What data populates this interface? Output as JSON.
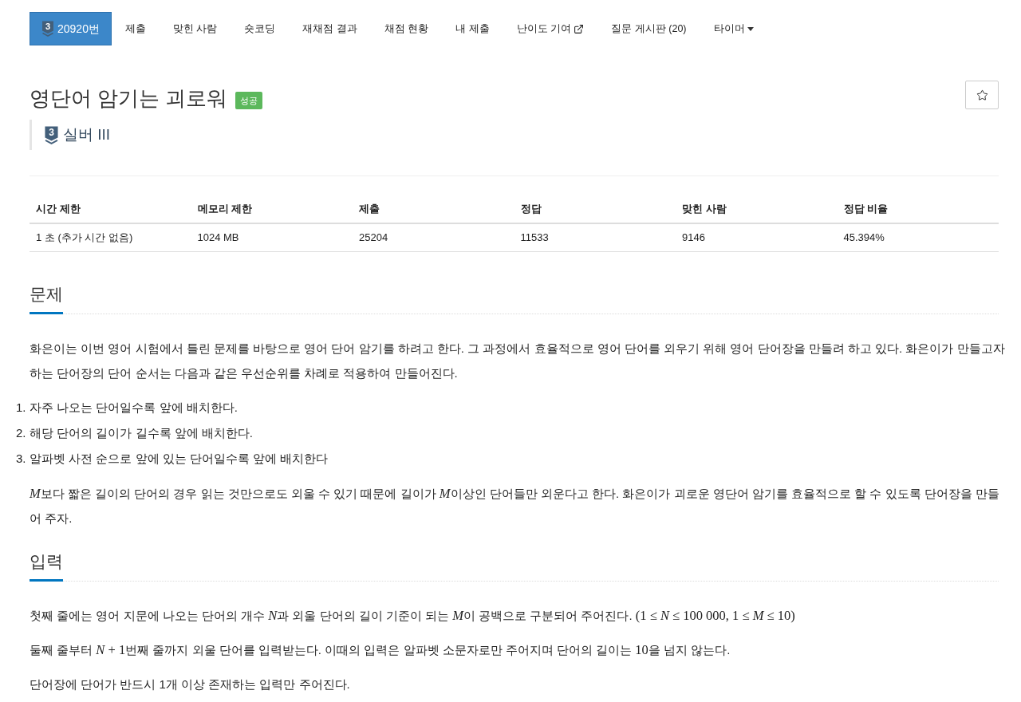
{
  "nav": {
    "tabs": [
      {
        "label": "20920번",
        "kind": "problem",
        "tier": "3",
        "selected": true
      },
      {
        "label": "제출",
        "kind": "plain",
        "selected": false
      },
      {
        "label": "맞힌 사람",
        "kind": "plain",
        "selected": false
      },
      {
        "label": "숏코딩",
        "kind": "plain",
        "selected": false
      },
      {
        "label": "재채점 결과",
        "kind": "plain",
        "selected": false
      },
      {
        "label": "채점 현황",
        "kind": "plain",
        "selected": false
      },
      {
        "label": "내 제출",
        "kind": "plain",
        "selected": false
      },
      {
        "label": "난이도 기여",
        "kind": "external",
        "selected": false
      },
      {
        "label": "질문 게시판 (20)",
        "kind": "plain",
        "selected": false
      },
      {
        "label": "타이머",
        "kind": "dropdown",
        "selected": false
      }
    ]
  },
  "problem": {
    "title": "영단어 암기는 괴로워",
    "status_badge": "성공",
    "starred": false,
    "tier": {
      "badge": "3",
      "name": "실버 III"
    }
  },
  "stats_table": {
    "columns": [
      "시간 제한",
      "메모리 제한",
      "제출",
      "정답",
      "맞힌 사람",
      "정답 비율"
    ],
    "rows": [
      [
        "1 초 (추가 시간 없음)",
        "1024 MB",
        "25204",
        "11533",
        "9146",
        "45.394%"
      ]
    ]
  },
  "sections": [
    {
      "heading": "문제",
      "blocks": [
        {
          "kind": "paragraph",
          "segments": [
            {
              "kind": "text",
              "text": "화은이는 이번 영어 시험에서 틀린 문제를 바탕으로 영어 단어 암기를 하려고 한다. 그 과정에서 효율적으로 영어 단어를 외우기 위해 영어 단어장을 만들려 하고 있다. 화은이가 만들고자 하는 단어장의 단어 순서는 다음과 같은 우선순위를 차례로 적용하여 만들어진다."
            }
          ]
        },
        {
          "kind": "list",
          "items": [
            {
              "marker": "1.",
              "text": "자주 나오는 단어일수록 앞에 배치한다."
            },
            {
              "marker": "2.",
              "text": "해당 단어의 길이가 길수록 앞에 배치한다."
            },
            {
              "marker": "3.",
              "text": "알파벳 사전 순으로 앞에 있는 단어일수록 앞에 배치한다"
            }
          ]
        },
        {
          "kind": "paragraph",
          "segments": [
            {
              "kind": "math",
              "text": "*M*"
            },
            {
              "kind": "text",
              "text": "보다 짧은 길이의 단어의 경우 읽는 것만으로도 외울 수 있기 때문에 길이가 "
            },
            {
              "kind": "math",
              "text": "*M*"
            },
            {
              "kind": "text",
              "text": "이상인 단어들만 외운다고 한다. 화은이가 괴로운 영단어 암기를 효율적으로 할 수 있도록 단어장을 만들어 주자."
            }
          ]
        }
      ]
    },
    {
      "heading": "입력",
      "blocks": [
        {
          "kind": "paragraph",
          "segments": [
            {
              "kind": "text",
              "text": "첫째 줄에는 영어 지문에 나오는 단어의 개수 "
            },
            {
              "kind": "math",
              "text": "*N*"
            },
            {
              "kind": "text",
              "text": "과 외울 단어의 길이 기준이 되는 "
            },
            {
              "kind": "math",
              "text": "*M*"
            },
            {
              "kind": "text",
              "text": "이 공백으로 구분되어 주어진다. "
            },
            {
              "kind": "math",
              "text": "(1 ≤ *N* ≤ 100 000, 1 ≤ *M* ≤ 10)"
            }
          ]
        },
        {
          "kind": "paragraph",
          "segments": [
            {
              "kind": "text",
              "text": "둘째 줄부터 "
            },
            {
              "kind": "math",
              "text": "*N* + 1"
            },
            {
              "kind": "text",
              "text": "번째 줄까지 외울 단어를 입력받는다. 이때의 입력은 알파벳 소문자로만 주어지며 단어의 길이는 "
            },
            {
              "kind": "math",
              "text": "10"
            },
            {
              "kind": "text",
              "text": "을 넘지 않는다."
            }
          ]
        },
        {
          "kind": "paragraph",
          "segments": [
            {
              "kind": "text",
              "text": "단어장에 단어가 반드시 1개 이상 존재하는 입력만 주어진다."
            }
          ]
        }
      ]
    }
  ]
}
